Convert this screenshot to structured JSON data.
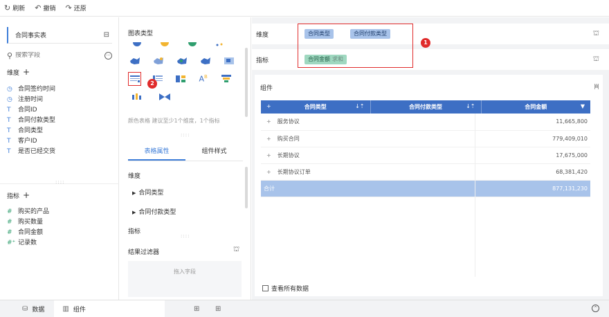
{
  "toolbar": {
    "refresh": "刷新",
    "undo": "撤销",
    "redo": "还原"
  },
  "left": {
    "table_name": "合同事实表",
    "search_placeholder": "搜索字段",
    "dimension_title": "维度",
    "dimension_fields": [
      {
        "icon": "clock-icon",
        "label": "合同签约时间"
      },
      {
        "icon": "clock-icon",
        "label": "注册时间"
      },
      {
        "icon": "text-icon",
        "label": "合同ID"
      },
      {
        "icon": "text-icon",
        "label": "合同付款类型"
      },
      {
        "icon": "text-icon",
        "label": "合同类型"
      },
      {
        "icon": "text-icon",
        "label": "客户ID"
      },
      {
        "icon": "text-icon",
        "label": "是否已经交货"
      }
    ],
    "measure_title": "指标",
    "measure_fields": [
      {
        "icon": "number-icon",
        "label": "购买的产品"
      },
      {
        "icon": "number-icon",
        "label": "购买数量"
      },
      {
        "icon": "number-icon",
        "label": "合同金额"
      },
      {
        "icon": "number-calc-icon",
        "label": "记录数"
      }
    ]
  },
  "middle": {
    "chart_type_title": "图表类型",
    "chart_hint": "颜色表格 建议至少1个维度，1个指标",
    "tabs": [
      "表格属性",
      "组件样式"
    ],
    "dimension_label": "维度",
    "dimension_items": [
      "合同类型",
      "合同付款类型"
    ],
    "measure_label": "指标",
    "filter_label": "结果过滤器",
    "filter_placeholder": "拖入字段",
    "badge": "2"
  },
  "right": {
    "dimension_shelf_label": "维度",
    "dimension_pills": [
      "合同类型",
      "合同付款类型"
    ],
    "measure_shelf_label": "指标",
    "measure_pill": "合同金额",
    "measure_agg": "求和",
    "badge": "1",
    "widget_title": "组件",
    "table": {
      "headers": [
        "合同类型",
        "合同付款类型",
        "合同金额"
      ],
      "rows": [
        {
          "name": "服务协议",
          "value": "11,665,800"
        },
        {
          "name": "购买合同",
          "value": "779,409,010"
        },
        {
          "name": "长期协议",
          "value": "17,675,000"
        },
        {
          "name": "长期协议订单",
          "value": "68,381,420"
        }
      ],
      "total_label": "合计",
      "total_value": "877,131,230"
    },
    "view_all": "查看所有数据"
  },
  "bottom": {
    "tab_data": "数据",
    "tab_widget": "组件"
  },
  "colors": {
    "accent": "#3d7dd8",
    "header_blue": "#3d6fc4",
    "highlight_red": "#e02b2b",
    "total_row": "#a8c3ea"
  }
}
